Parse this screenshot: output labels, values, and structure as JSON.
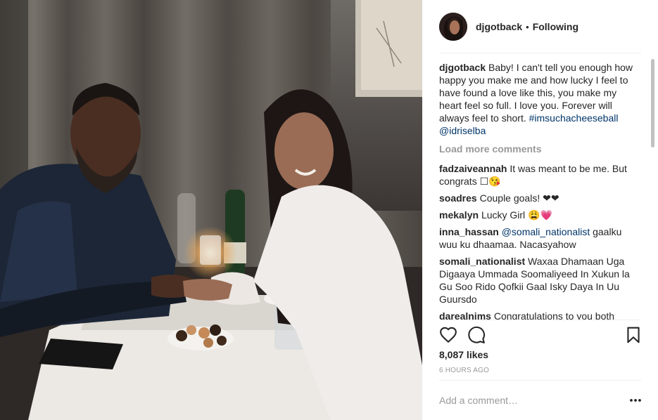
{
  "post": {
    "username": "djgotback",
    "separator": "•",
    "follow_status": "Following",
    "caption_user": "djgotback",
    "caption_text": "Baby! I can't tell you enough how happy you make me and how lucky I feel to have found a love like this, you make my heart feel so full. I love you. Forever will always feel to short.",
    "caption_hashtag": "#imsuchacheeseball",
    "caption_mention": "@idriselba",
    "load_more": "Load more comments",
    "likes": "8,087 likes",
    "time": "6 HOURS AGO",
    "add_comment_placeholder": "Add a comment…"
  },
  "comments": [
    {
      "user": "fadzaiveannah",
      "text": "It was meant to be me. But congrats ☐😘"
    },
    {
      "user": "soadres",
      "text": "Couple goals! ❤❤"
    },
    {
      "user": "mekalyn",
      "text": "Lucky Girl 😩💗"
    },
    {
      "user": "inna_hassan",
      "mention": "@somali_nationalist",
      "text": "gaalku wuu ku dhaamaa. Nacasyahow"
    },
    {
      "user": "somali_nationalist",
      "text": "Waxaa Dhamaan Uga Digaaya Ummada Soomaliyeed In Xukun la Gu Soo Rido Qofkii Gaal Isky Daya In Uu Guursdo"
    },
    {
      "user": "darealnims",
      "text": "Congratulations to you both"
    }
  ],
  "icons": {
    "like": "heart-icon",
    "comment": "speech-bubble-icon",
    "save": "bookmark-icon",
    "more": "more-options-icon"
  },
  "colors": {
    "text": "#262626",
    "muted": "#999999",
    "link": "#003569",
    "divider": "#efefef"
  }
}
